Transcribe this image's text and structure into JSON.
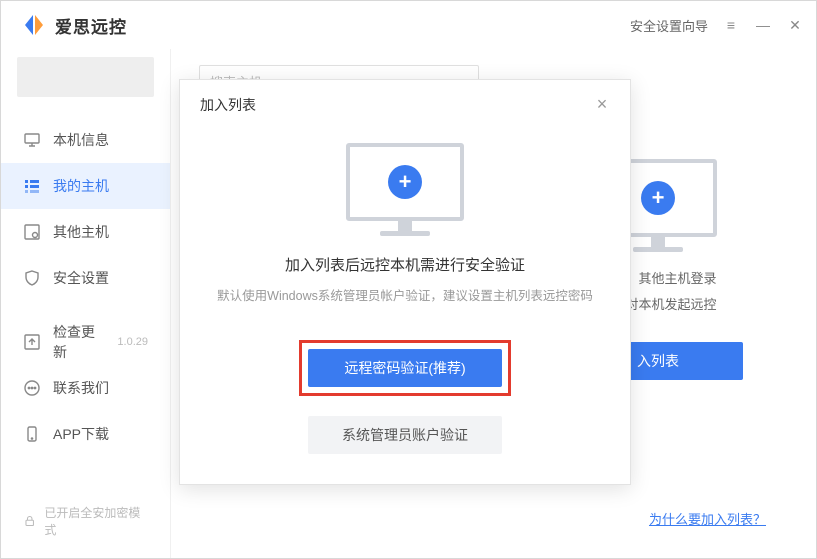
{
  "titlebar": {
    "brand": "爱思远控",
    "wizard": "安全设置向导"
  },
  "sidebar": {
    "items": [
      {
        "label": "本机信息"
      },
      {
        "label": "我的主机"
      },
      {
        "label": "其他主机"
      },
      {
        "label": "安全设置"
      }
    ],
    "utility": [
      {
        "label": "检查更新",
        "version": "1.0.29"
      },
      {
        "label": "联系我们"
      },
      {
        "label": "APP下载"
      }
    ],
    "encrypt": "已开启全安加密模式"
  },
  "content": {
    "search_placeholder": "搜索主机",
    "bg_line1": "列表，其他主机登录",
    "bg_line2": "轻松对本机发起远控",
    "bg_button": "入列表",
    "why_link": "为什么要加入列表？"
  },
  "modal": {
    "title": "加入列表",
    "heading": "加入列表后远控本机需进行安全验证",
    "sub": "默认使用Windows系统管理员帐户验证，建议设置主机列表远控密码",
    "btn_primary": "远程密码验证(推荐)",
    "btn_secondary": "系统管理员账户验证"
  }
}
